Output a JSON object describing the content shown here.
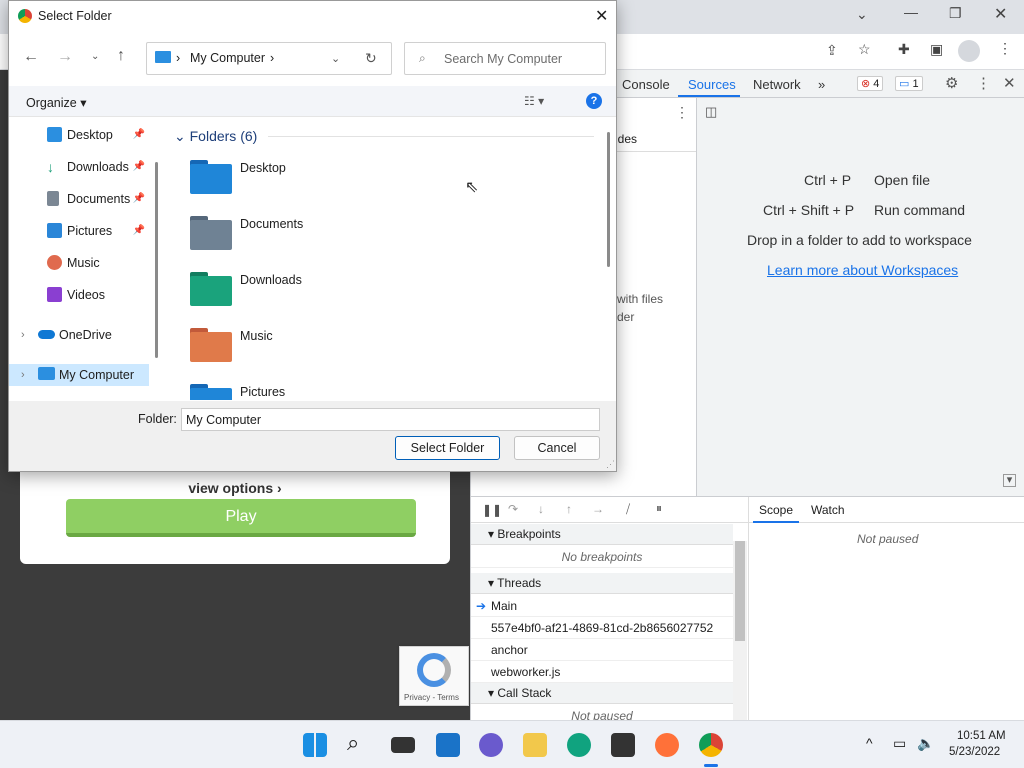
{
  "dialog": {
    "title": "Select Folder",
    "address": [
      "My Computer"
    ],
    "search_placeholder": "Search My Computer",
    "organize_label": "Organize",
    "nav_items": [
      {
        "label": "Desktop",
        "icon": "desktop-icon",
        "color": "#2b8fe0",
        "pinned": true
      },
      {
        "label": "Downloads",
        "icon": "download-icon",
        "color": "#1ea07a",
        "pinned": true
      },
      {
        "label": "Documents",
        "icon": "documents-icon",
        "color": "#7b8794",
        "pinned": true
      },
      {
        "label": "Pictures",
        "icon": "pictures-icon",
        "color": "#2a86d8",
        "pinned": true
      },
      {
        "label": "Music",
        "icon": "music-icon",
        "color": "#e06a4e",
        "pinned": false
      },
      {
        "label": "Videos",
        "icon": "videos-icon",
        "color": "#8a3fd1",
        "pinned": false
      },
      {
        "label": "OneDrive",
        "icon": "onedrive-icon",
        "color": "#0f78d4",
        "pinned": false
      },
      {
        "label": "My Computer",
        "icon": "computer-icon",
        "color": "#2b8fe0",
        "pinned": false,
        "selected": true
      }
    ],
    "group_header": "Folders (6)",
    "folders": [
      {
        "name": "Desktop",
        "color": "#1f86d8"
      },
      {
        "name": "Documents",
        "color": "#6f8294"
      },
      {
        "name": "Downloads",
        "color": "#1aa37c"
      },
      {
        "name": "Music",
        "color": "#e07a4a"
      },
      {
        "name": "Pictures",
        "color": "#1f86d8"
      }
    ],
    "folder_label": "Folder:",
    "folder_value": "My Computer",
    "select_button": "Select Folder",
    "cancel_button": "Cancel"
  },
  "page": {
    "view_options": "view options",
    "play_button": "Play",
    "recaptcha_text": "Privacy - Terms"
  },
  "devtools": {
    "tabs": [
      "Console",
      "Sources",
      "Network"
    ],
    "active_tab": "Sources",
    "error_count": "4",
    "message_count": "1",
    "side_snippets": [
      "ides",
      "with files",
      "der"
    ],
    "shortcuts": [
      {
        "keys": "Ctrl + P",
        "action": "Open file"
      },
      {
        "keys": "Ctrl + Shift + P",
        "action": "Run command"
      }
    ],
    "drop_text": "Drop in a folder to add to workspace",
    "learn_link": "Learn more about Workspaces",
    "right_tabs": [
      "Scope",
      "Watch"
    ],
    "not_paused": "Not paused",
    "sections": {
      "breakpoints": "Breakpoints",
      "no_breakpoints": "No breakpoints",
      "threads": "Threads",
      "thread_list": [
        "Main",
        "557e4bf0-af21-4869-81cd-2b8656027752",
        "anchor",
        "webworker.js"
      ],
      "call_stack": "Call Stack",
      "call_stack_state": "Not paused"
    }
  },
  "taskbar": {
    "time": "10:51 AM",
    "date": "5/23/2022"
  }
}
